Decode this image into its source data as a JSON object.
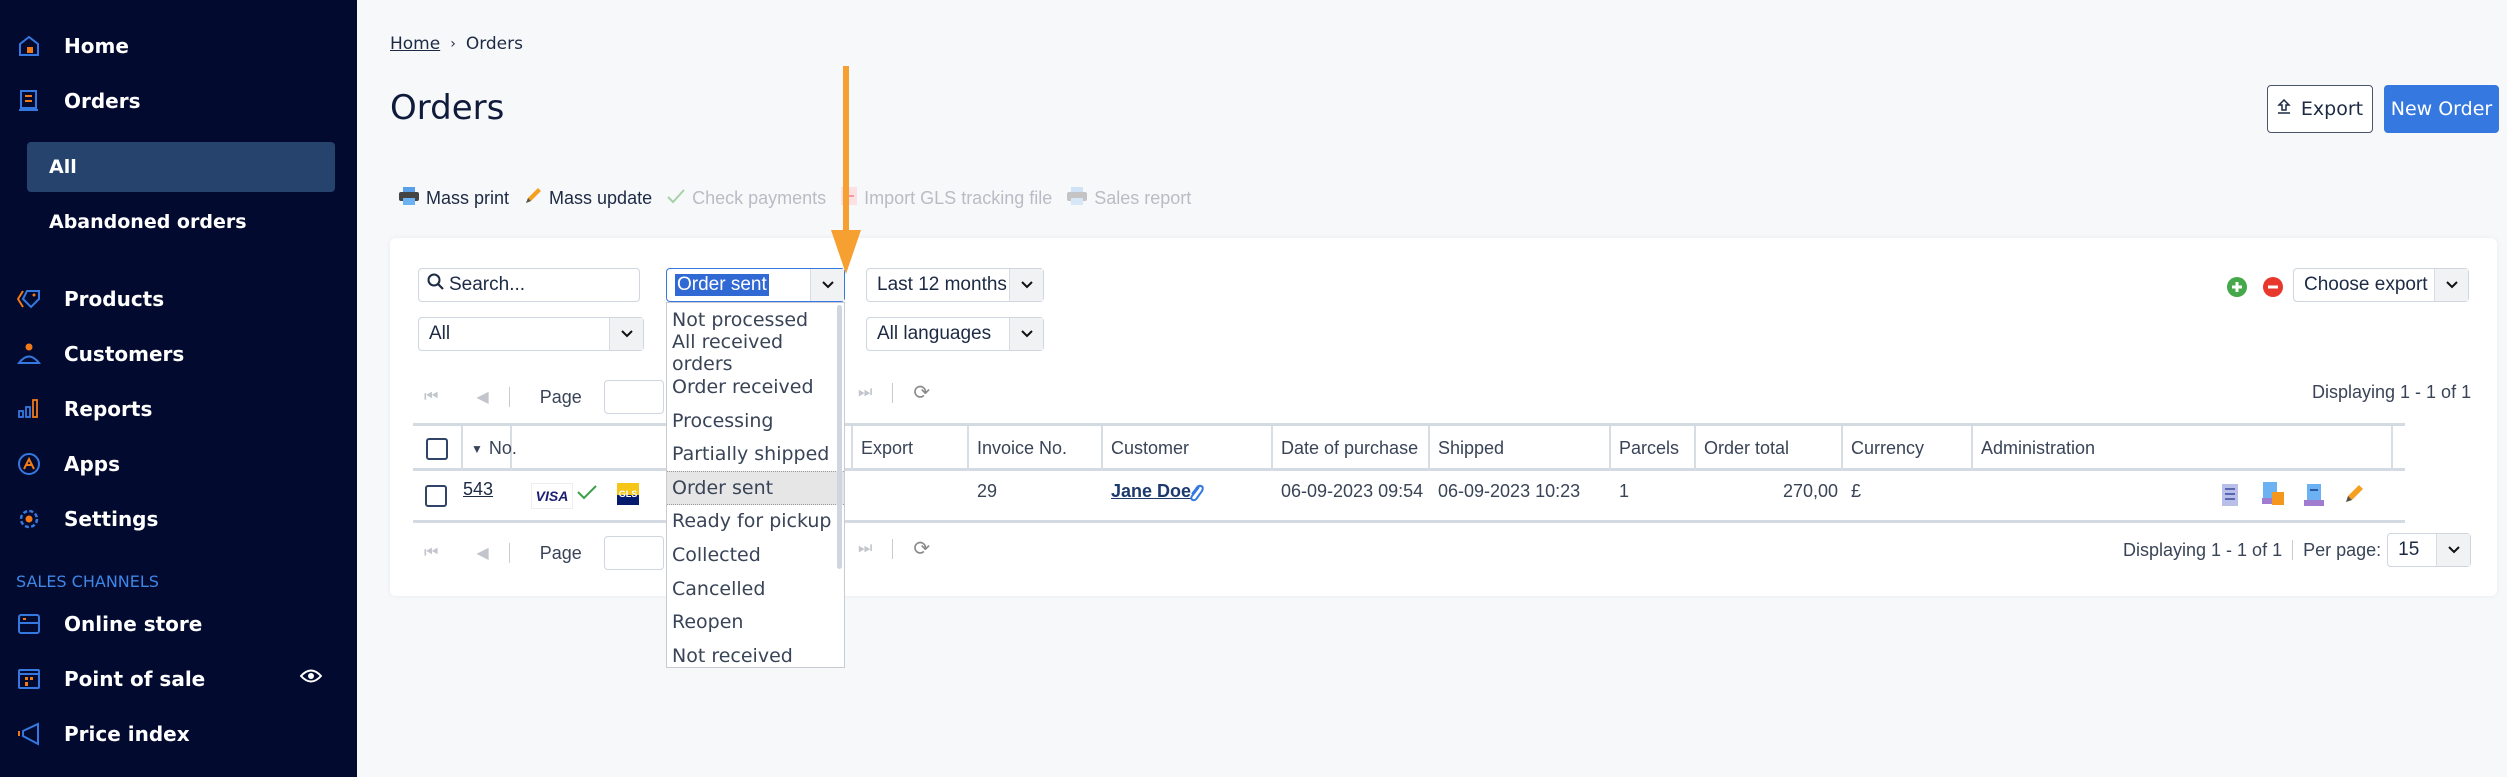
{
  "sidebar": {
    "items": [
      {
        "label": "Home",
        "icon": "home-icon"
      },
      {
        "label": "Orders",
        "icon": "orders-icon"
      },
      {
        "label": "Products",
        "icon": "tag-icon"
      },
      {
        "label": "Customers",
        "icon": "user-icon"
      },
      {
        "label": "Reports",
        "icon": "bar-chart-icon"
      },
      {
        "label": "Apps",
        "icon": "apps-icon"
      },
      {
        "label": "Settings",
        "icon": "gear-icon"
      }
    ],
    "orders_sub": [
      {
        "label": "All",
        "active": true
      },
      {
        "label": "Abandoned orders",
        "active": false
      }
    ],
    "section_label": "SALES CHANNELS",
    "channels": [
      {
        "label": "Online store",
        "icon": "store-icon"
      },
      {
        "label": "Point of sale",
        "icon": "pos-icon"
      },
      {
        "label": "Price index",
        "icon": "megaphone-icon"
      }
    ]
  },
  "breadcrumb": {
    "home": "Home",
    "current": "Orders"
  },
  "page": {
    "title": "Orders",
    "export_label": "Export",
    "new_order_label": "New Order"
  },
  "toolbar": [
    {
      "label": "Mass print",
      "icon": "printer-icon",
      "enabled": true
    },
    {
      "label": "Mass update",
      "icon": "pencil-icon",
      "enabled": true
    },
    {
      "label": "Check payments",
      "icon": "check-icon",
      "enabled": false
    },
    {
      "label": "Import GLS tracking file",
      "icon": "import-icon",
      "enabled": false
    },
    {
      "label": "Sales report",
      "icon": "printer-icon",
      "enabled": false
    }
  ],
  "filters": {
    "search_placeholder": "Search...",
    "status_selected": "Order sent",
    "period_selected": "Last 12 months",
    "type_selected": "All",
    "language_selected": "All languages",
    "export_selected": "Choose export"
  },
  "status_options": [
    "Not processed",
    "All received orders",
    "Order received",
    "Processing",
    "Partially shipped",
    "Order sent",
    "Ready for pickup",
    "Collected",
    "Cancelled",
    "Reopen",
    "Not received"
  ],
  "pager": {
    "page_label": "Page",
    "display_text": "Displaying 1 - 1 of 1",
    "per_page_label": "Per page:",
    "per_page_value": "15"
  },
  "table": {
    "columns": [
      "No.",
      "",
      "Export",
      "Invoice No.",
      "Customer",
      "Date of purchase",
      "Shipped",
      "Parcels",
      "Order total",
      "Currency",
      "Administration"
    ],
    "rows": [
      {
        "no": "543",
        "payment": "VISA",
        "carrier": "GLS",
        "invoice": "29",
        "customer": "Jane Doe",
        "date": "06-09-2023 09:54",
        "shipped": "06-09-2023 10:23",
        "parcels": "1",
        "total": "270,00",
        "currency": "£"
      }
    ]
  }
}
